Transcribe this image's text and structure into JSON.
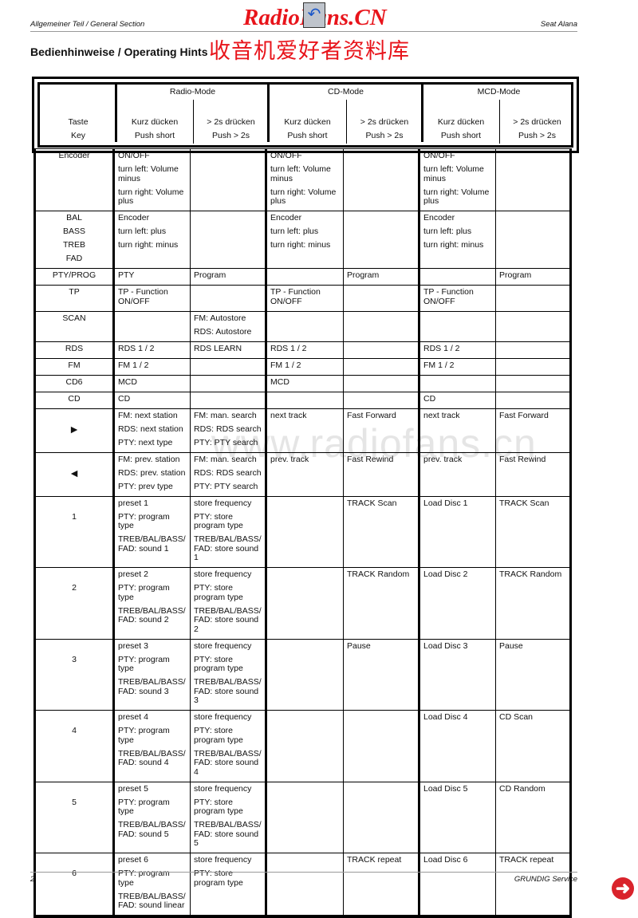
{
  "header": {
    "left": "Allgemeiner Teil / General Section",
    "right": "Seat Alana"
  },
  "title": "Bedienhinweise / Operating Hints",
  "watermark": {
    "logo": "RadioFans.CN",
    "chinese": "收音机爱好者资料库",
    "url": "www.radiofans.cn"
  },
  "table": {
    "key_header": [
      "Taste",
      "Key"
    ],
    "modes": [
      "Radio-Mode",
      "CD-Mode",
      "MCD-Mode"
    ],
    "sub_headers": [
      [
        "Kurz dücken",
        "Push short"
      ],
      [
        "> 2s drücken",
        "Push > 2s"
      ],
      [
        "Kurz dücken",
        "Push short"
      ],
      [
        "> 2s drücken",
        "Push > 2s"
      ],
      [
        "Kurz dücken",
        "Push short"
      ],
      [
        "> 2s drücken",
        "Push > 2s"
      ]
    ],
    "rows": [
      {
        "key": [
          "Encoder"
        ],
        "cells": [
          [
            "ON/OFF",
            "turn left: Volume\nminus",
            "turn right: Volume\nplus"
          ],
          [],
          [
            "ON/OFF",
            "turn left: Volume\nminus",
            "turn right: Volume\nplus"
          ],
          [],
          [
            "ON/OFF",
            "turn left: Volume\nminus",
            "turn right: Volume\nplus"
          ],
          []
        ]
      },
      {
        "key": [
          "BAL",
          "BASS",
          "TREB",
          "FAD"
        ],
        "cells": [
          [
            "Encoder",
            "turn left:    plus",
            "turn right: minus"
          ],
          [],
          [
            "Encoder",
            "turn left:    plus",
            "turn right: minus"
          ],
          [],
          [
            "Encoder",
            "turn left:    plus",
            "turn right: minus"
          ],
          []
        ]
      },
      {
        "key": [
          "PTY/PROG"
        ],
        "cells": [
          [
            "PTY"
          ],
          [
            "Program"
          ],
          [],
          [
            "Program"
          ],
          [],
          [
            "Program"
          ]
        ]
      },
      {
        "key": [
          "TP"
        ],
        "cells": [
          [
            "TP - Function\nON/OFF"
          ],
          [],
          [
            "TP - Function\nON/OFF"
          ],
          [],
          [
            "TP - Function\nON/OFF"
          ],
          []
        ]
      },
      {
        "key": [
          "SCAN"
        ],
        "cells": [
          [],
          [
            "FM: Autostore",
            "RDS: Autostore"
          ],
          [],
          [],
          [],
          []
        ]
      },
      {
        "key": [
          "RDS"
        ],
        "cells": [
          [
            "RDS 1 / 2"
          ],
          [
            "RDS LEARN"
          ],
          [
            "RDS 1 / 2"
          ],
          [],
          [
            "RDS 1 / 2"
          ],
          []
        ]
      },
      {
        "key": [
          "FM"
        ],
        "cells": [
          [
            "FM  1 / 2"
          ],
          [],
          [
            "FM  1 / 2"
          ],
          [],
          [
            "FM  1 / 2"
          ],
          []
        ]
      },
      {
        "key": [
          "CD6"
        ],
        "cells": [
          [
            "MCD"
          ],
          [],
          [
            "MCD"
          ],
          [],
          [],
          []
        ]
      },
      {
        "key": [
          "CD"
        ],
        "cells": [
          [
            "CD"
          ],
          [],
          [],
          [],
          [
            "CD"
          ],
          []
        ]
      },
      {
        "key": [
          "",
          "►"
        ],
        "cells": [
          [
            "FM: next station",
            "RDS: next station",
            "PTY: next type"
          ],
          [
            "FM: man. search",
            "RDS: RDS search",
            "PTY: PTY search"
          ],
          [
            "next track"
          ],
          [
            "Fast Forward"
          ],
          [
            "next track"
          ],
          [
            "Fast Forward"
          ]
        ]
      },
      {
        "key": [
          "",
          "◄"
        ],
        "cells": [
          [
            "FM: prev. station",
            "RDS: prev. station",
            "PTY: prev type"
          ],
          [
            "FM: man. search",
            "RDS: RDS search",
            "PTY: PTY search"
          ],
          [
            "prev. track"
          ],
          [
            "Fast Rewind"
          ],
          [
            "prev. track"
          ],
          [
            "Fast Rewind"
          ]
        ]
      },
      {
        "key": [
          "",
          "1"
        ],
        "cells": [
          [
            "preset 1",
            "PTY: program\ntype",
            "TREB/BAL/BASS/\nFAD: sound 1"
          ],
          [
            "store frequency",
            "PTY: store\nprogram type",
            "TREB/BAL/BASS/\nFAD: store sound 1"
          ],
          [],
          [
            "TRACK Scan"
          ],
          [
            "Load Disc 1"
          ],
          [
            "TRACK Scan"
          ]
        ]
      },
      {
        "key": [
          "",
          "2"
        ],
        "cells": [
          [
            "preset 2",
            "PTY: program\ntype",
            "TREB/BAL/BASS/\nFAD: sound 2"
          ],
          [
            "store frequency",
            "PTY: store\nprogram type",
            "TREB/BAL/BASS/\nFAD: store sound 2"
          ],
          [],
          [
            "TRACK Random"
          ],
          [
            "Load Disc 2"
          ],
          [
            "TRACK Random"
          ]
        ]
      },
      {
        "key": [
          "",
          "3"
        ],
        "cells": [
          [
            "preset 3",
            "PTY: program\ntype",
            "TREB/BAL/BASS/\nFAD: sound 3"
          ],
          [
            "store frequency",
            "PTY: store\nprogram type",
            "TREB/BAL/BASS/\nFAD: store sound 3"
          ],
          [],
          [
            "Pause"
          ],
          [
            "Load Disc 3"
          ],
          [
            "Pause"
          ]
        ]
      },
      {
        "key": [
          "",
          "4"
        ],
        "cells": [
          [
            "preset 4",
            "PTY: program\ntype",
            "TREB/BAL/BASS/\nFAD: sound 4"
          ],
          [
            "store frequency",
            "PTY: store\nprogram type",
            "TREB/BAL/BASS/\nFAD: store sound 4"
          ],
          [],
          [],
          [
            "Load Disc 4"
          ],
          [
            "CD Scan"
          ]
        ]
      },
      {
        "key": [
          "",
          "5"
        ],
        "cells": [
          [
            "preset 5",
            "PTY: program\ntype",
            "TREB/BAL/BASS/\nFAD: sound 5"
          ],
          [
            "store frequency",
            "PTY: store\nprogram type",
            "TREB/BAL/BASS/\nFAD: store sound 5"
          ],
          [],
          [],
          [
            "Load Disc 5"
          ],
          [
            "CD Random"
          ]
        ]
      },
      {
        "key": [
          "",
          "6"
        ],
        "cells": [
          [
            "preset 6",
            "PTY: program\ntype",
            "TREB/BAL/BASS/\nFAD: sound linear"
          ],
          [
            "store frequency",
            "PTY: store\nprogram type"
          ],
          [],
          [
            "TRACK repeat"
          ],
          [
            "Load Disc 6"
          ],
          [
            "TRACK repeat"
          ]
        ]
      }
    ]
  },
  "footer": {
    "page": "2",
    "right": "GRUNDIG Service"
  },
  "colors": {
    "watermark": "#e8141b",
    "next_button": "#d9232b"
  },
  "icons": {
    "next": "arrow-right-circle-icon",
    "back": "back-arrow-icon"
  }
}
